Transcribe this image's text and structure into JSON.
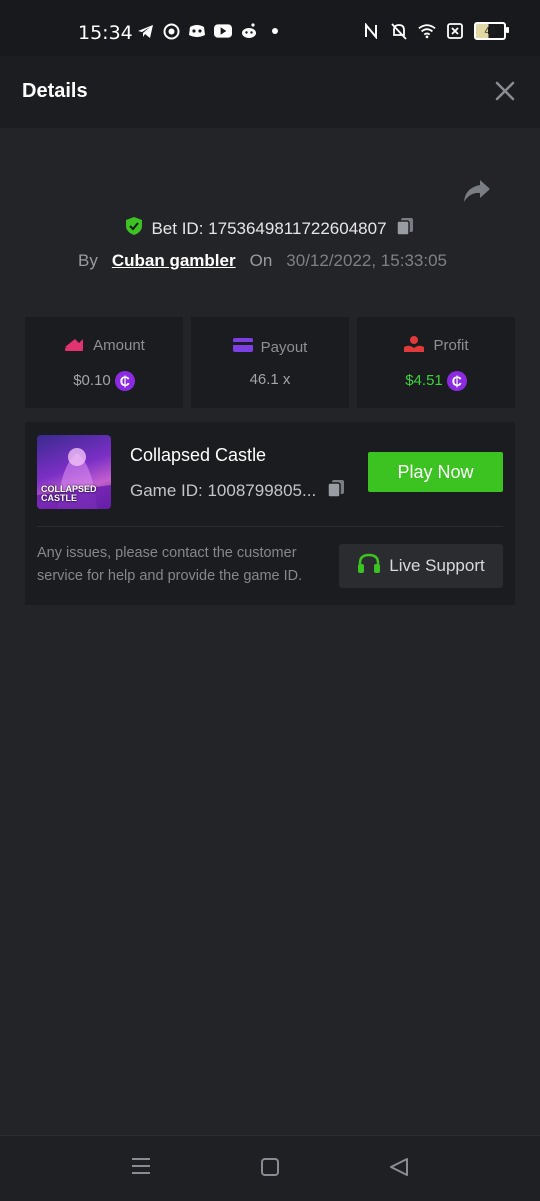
{
  "status_bar": {
    "time": "15:34",
    "battery": "46",
    "icons": [
      "telegram-icon",
      "whatsapp-icon",
      "discord-icon",
      "youtube-icon",
      "reddit-icon",
      "dot-icon",
      "nfc-icon",
      "mute-icon",
      "wifi-icon",
      "sim-icon",
      "battery-icon"
    ]
  },
  "header": {
    "title": "Details"
  },
  "bet": {
    "id_label": "Bet ID: 1753649811722604807",
    "by_label": "By",
    "user": "Cuban gambler",
    "on_label": "On",
    "date": "30/12/2022, 15:33:05"
  },
  "stats": {
    "amount_label": "Amount",
    "amount_value": "$0.10",
    "payout_label": "Payout",
    "payout_value": "46.1 x",
    "profit_label": "Profit",
    "profit_value": "$4.51"
  },
  "game": {
    "thumb_text_1": "COLLAPSED",
    "thumb_text_2": "CASTLE",
    "name": "Collapsed Castle",
    "id_label": "Game ID: 1008799805...",
    "play_label": "Play Now",
    "issue_text": "Any issues, please contact the customer service for help and provide the game ID.",
    "support_label": "Live Support"
  },
  "colors": {
    "accent_green": "#3cc221",
    "coin_purple": "#8a2be2",
    "profit_green": "#3bd33b"
  }
}
